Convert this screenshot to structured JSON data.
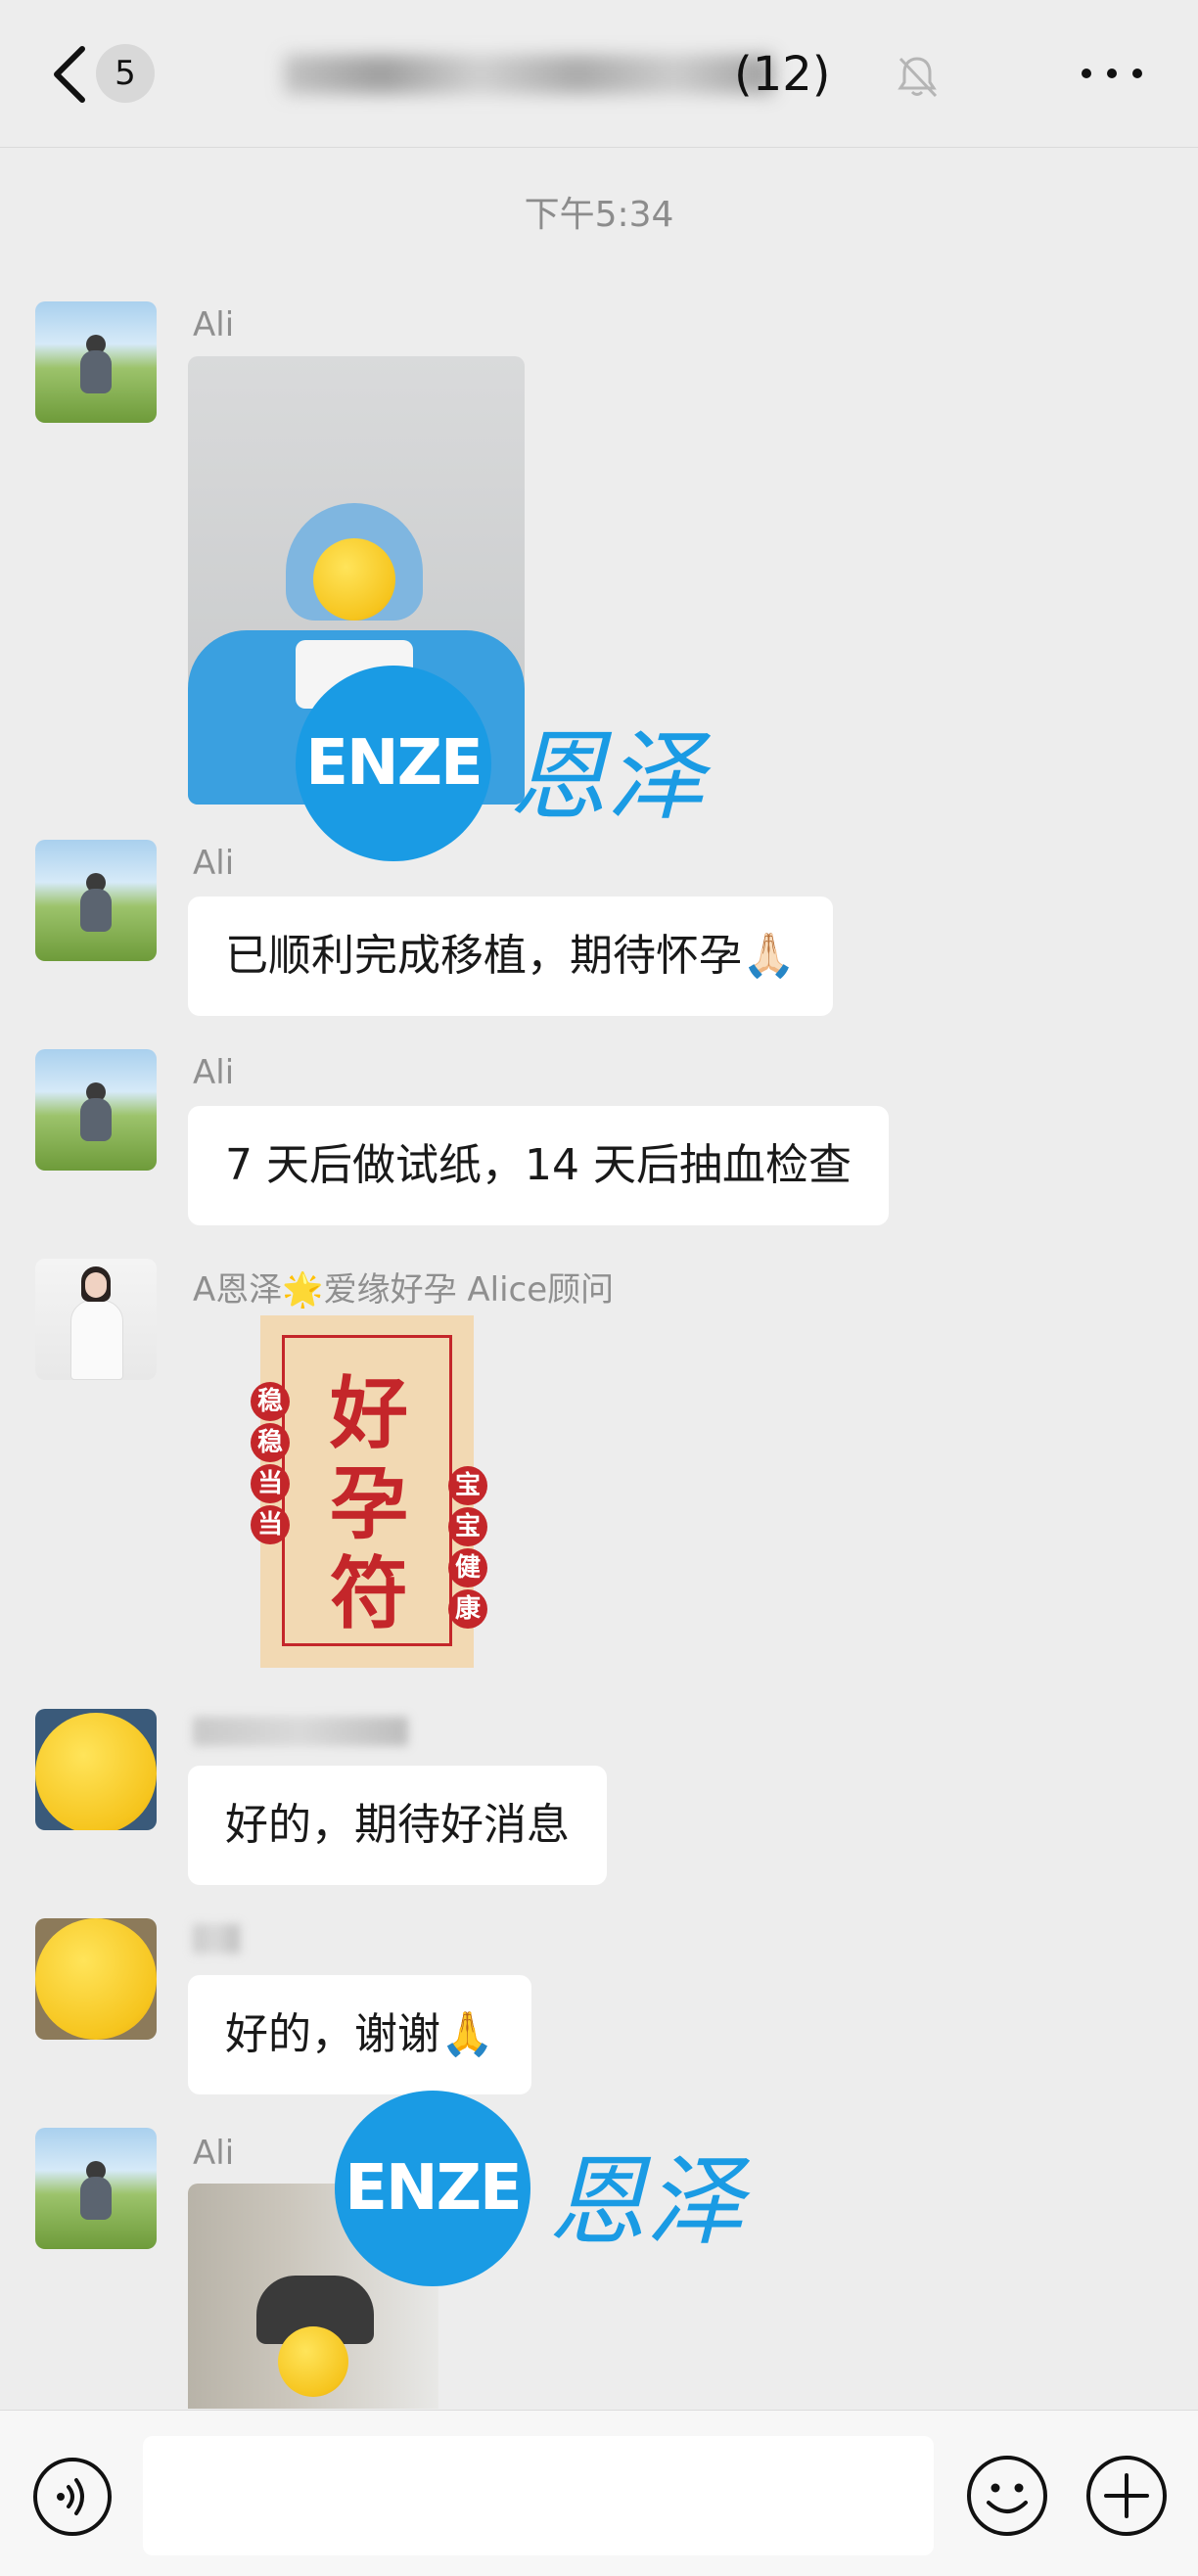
{
  "header": {
    "back_count": "5",
    "title_visible": "(12)"
  },
  "messages": {
    "time": "下午5:34",
    "m1_sender": "Ali",
    "m2_sender": "Ali",
    "m2_text": "已顺利完成移植，期待怀孕🙏🏻",
    "m3_sender": "Ali",
    "m3_text": "7 天后做试纸，14 天后抽血检查",
    "m4_sender": "A恩泽🌟爱缘好孕 Alice顾问",
    "m5_text": "好的，期待好消息",
    "m6_text": "好的，谢谢🙏",
    "m7_sender": "Ali"
  },
  "watermark": {
    "logo": "ENZE",
    "name": "恩泽"
  },
  "sticker": {
    "main": "好孕符",
    "left_seals": [
      "稳",
      "稳",
      "当",
      "当"
    ],
    "right_seals": [
      "宝",
      "宝",
      "健",
      "康"
    ]
  },
  "colors": {
    "background": "#ededed",
    "bubble": "#ffffff",
    "brand_blue": "#1a9be4",
    "seal_red": "#c4262a"
  },
  "icons": {
    "back": "chevron-left-icon",
    "mute": "bell-off-icon",
    "more": "more-dots-icon",
    "voice": "voice-icon",
    "emoji": "emoji-icon",
    "plus": "plus-icon"
  }
}
